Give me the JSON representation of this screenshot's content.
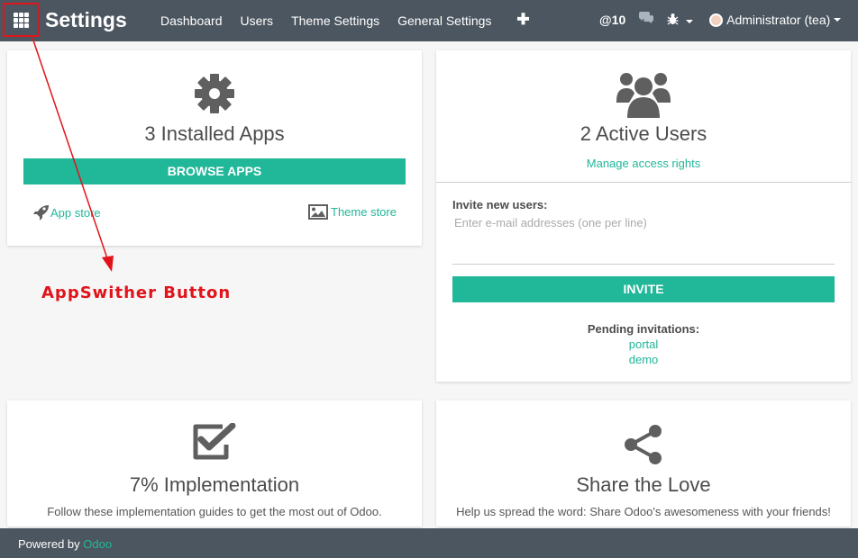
{
  "nav": {
    "title": "Settings",
    "menu": [
      "Dashboard",
      "Users",
      "Theme Settings",
      "General Settings"
    ],
    "add_glyph": "✚",
    "mentions": "@10",
    "user": "Administrator (tea)",
    "icons": [
      "app-switcher-icon",
      "chat-icon",
      "bug-icon",
      "avatar"
    ]
  },
  "apps": {
    "title": "3 Installed Apps",
    "browse": "BROWSE APPS",
    "app_store": "App store",
    "theme_store": "Theme store"
  },
  "users": {
    "title": "2 Active Users",
    "manage": "Manage access rights",
    "invite_label": "Invite new users:",
    "invite_placeholder": "Enter e-mail addresses (one per line)",
    "invite_button": "INVITE",
    "pending_label": "Pending invitations:",
    "pending": [
      "portal",
      "demo"
    ]
  },
  "implementation": {
    "title": "7% Implementation",
    "subtitle": "Follow these implementation guides to get the most out of Odoo."
  },
  "share": {
    "title": "Share the Love",
    "subtitle": "Help us spread the word: Share Odoo's awesomeness with your friends!"
  },
  "footer": {
    "powered": "Powered by",
    "brand": "Odoo"
  },
  "annotation": {
    "label": "AppSwither Button",
    "color": "#e0141a"
  },
  "colors": {
    "nav_bg": "#4c5660",
    "accent": "#21b799"
  }
}
